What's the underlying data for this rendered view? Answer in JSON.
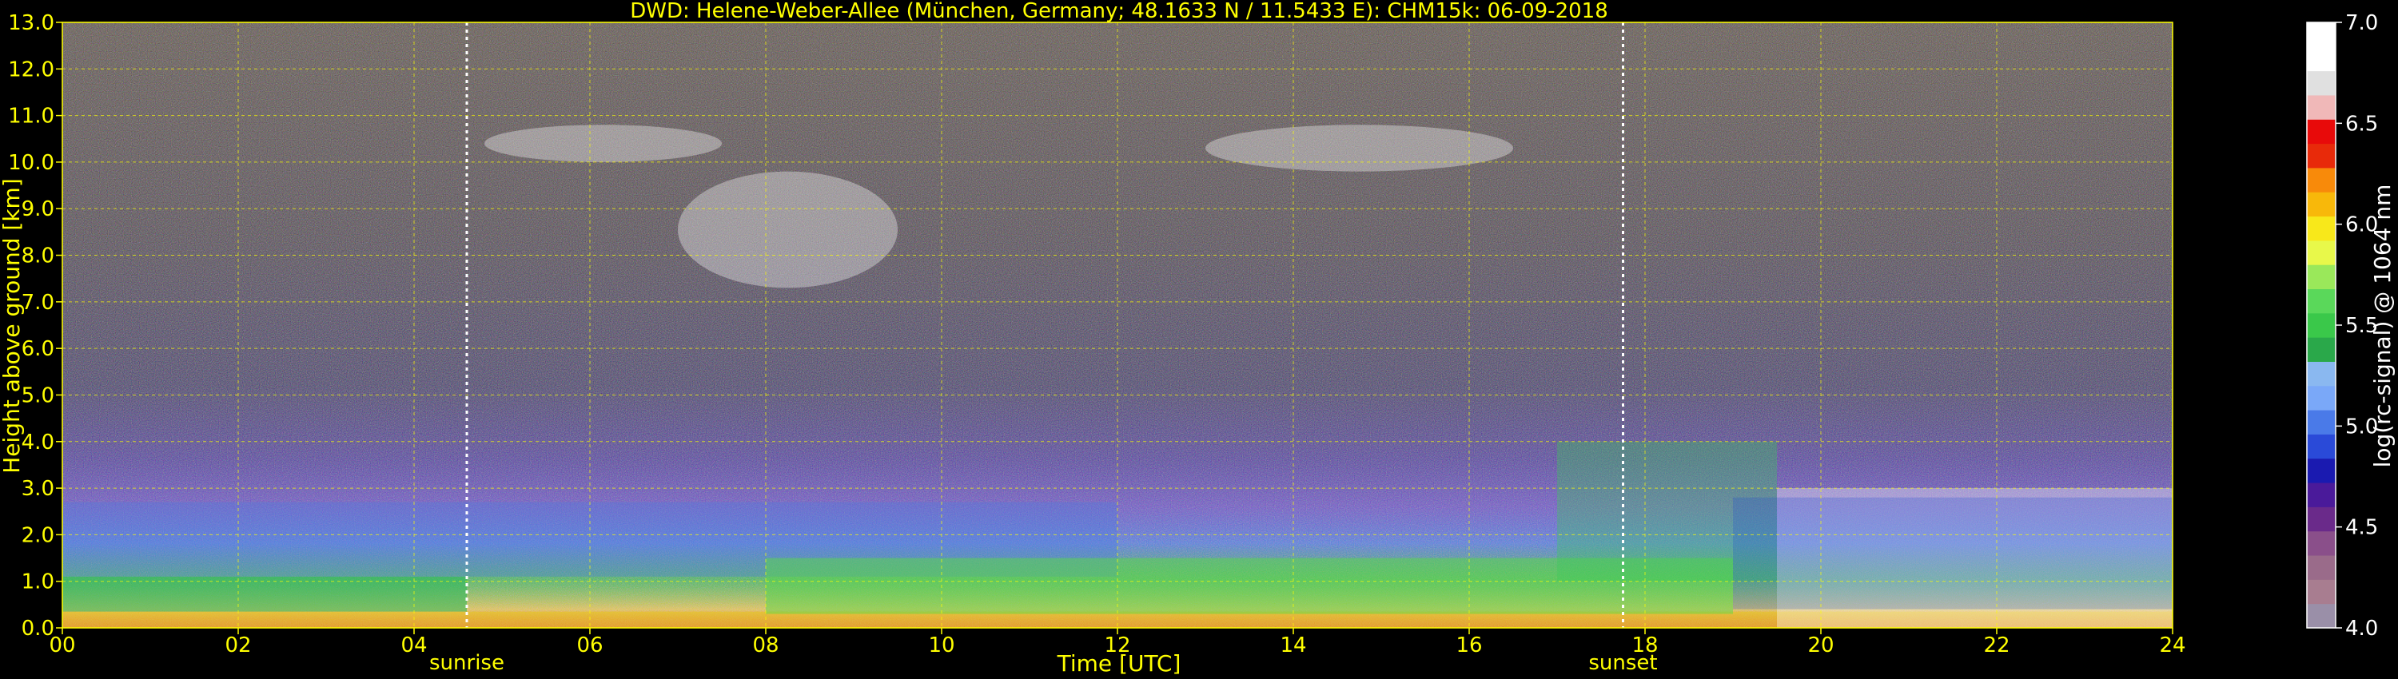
{
  "chart_data": {
    "type": "heatmap",
    "title": "DWD: Helene-Weber-Allee (München, Germany; 48.1633 N / 11.5433 E):    CHM15k: 06-09-2018",
    "xlabel": "Time [UTC]",
    "ylabel": "Height above ground [km]",
    "xlim": [
      0,
      24
    ],
    "ylim": [
      0,
      13
    ],
    "xticks": [
      "00",
      "02",
      "04",
      "06",
      "08",
      "10",
      "12",
      "14",
      "16",
      "18",
      "20",
      "22",
      "24"
    ],
    "yticks": [
      "0.0",
      "1.0",
      "2.0",
      "3.0",
      "4.0",
      "5.0",
      "6.0",
      "7.0",
      "8.0",
      "9.0",
      "10.0",
      "11.0",
      "12.0",
      "13.0"
    ],
    "grid": true,
    "sunrise": {
      "label": "sunrise",
      "time": 4.6
    },
    "sunset": {
      "label": "sunset",
      "time": 17.75
    },
    "colorbar": {
      "label": "log(rc-signal) @ 1064 nm",
      "range": [
        4.0,
        7.0
      ],
      "ticks": [
        "4.0",
        "4.5",
        "5.0",
        "5.5",
        "6.0",
        "6.5",
        "7.0"
      ],
      "colors": [
        "#9a8fa8",
        "#a87d90",
        "#9a6b8a",
        "#8a4f8a",
        "#6a2a8a",
        "#4a1a9a",
        "#1a1ab0",
        "#2a4ad8",
        "#4a7ae8",
        "#7aa8f8",
        "#8ab8f0",
        "#2aa84a",
        "#3ac84a",
        "#5ad85a",
        "#9ae85a",
        "#e8f84a",
        "#f8e81a",
        "#f8b80a",
        "#f88a0a",
        "#e82a0a",
        "#e80a0a",
        "#f0b8b8",
        "#e0e0e0",
        "#ffffff",
        "#ffffff"
      ]
    }
  }
}
